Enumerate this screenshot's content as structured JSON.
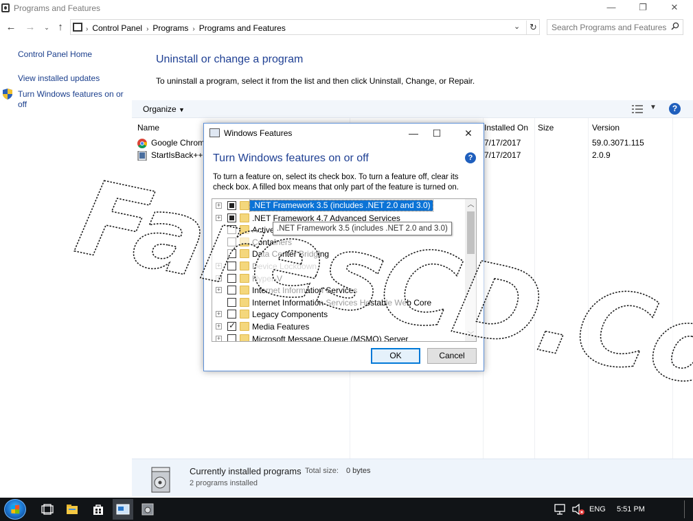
{
  "window": {
    "title": "Programs and Features",
    "min": "—",
    "max": "❐",
    "close": "✕"
  },
  "address": {
    "crumbs": [
      "Control Panel",
      "Programs",
      "Programs and Features"
    ],
    "search_placeholder": "Search Programs and Features"
  },
  "left_pane": {
    "home": "Control Panel Home",
    "updates": "View installed updates",
    "features_line1": "Turn Windows features on or",
    "features_line2": "off"
  },
  "main": {
    "title": "Uninstall or change a program",
    "desc": "To uninstall a program, select it from the list and then click Uninstall, Change, or Repair.",
    "organize": "Organize",
    "columns": {
      "name": "Name",
      "installed_on": "Installed On",
      "size": "Size",
      "version": "Version"
    },
    "programs": [
      {
        "name": "Google Chrom",
        "installed_on": "7/17/2017",
        "size": "",
        "version": "59.0.3071.115"
      },
      {
        "name": "StartIsBack++",
        "installed_on": "7/17/2017",
        "size": "",
        "version": "2.0.9"
      }
    ]
  },
  "details": {
    "title": "Currently installed programs",
    "total_label": "Total size:",
    "total_value": "0 bytes",
    "count": "2 programs installed"
  },
  "dialog": {
    "title": "Windows Features",
    "heading": "Turn Windows features on or off",
    "instructions": "To turn a feature on, select its check box. To turn a feature off, clear its check box. A filled box means that only part of the feature is turned on.",
    "features": [
      {
        "label": ".NET Framework 3.5 (includes .NET 2.0 and 3.0)",
        "state": "partial",
        "expandable": true,
        "selected": true
      },
      {
        "label": ".NET Framework 4.7 Advanced Services",
        "state": "partial",
        "expandable": true
      },
      {
        "label": "Active",
        "state": "unchecked",
        "expandable": false
      },
      {
        "label": "Containers",
        "state": "unchecked",
        "expandable": false
      },
      {
        "label": "Data Center Bridging",
        "state": "unchecked",
        "expandable": false
      },
      {
        "label": "Device Lockdown",
        "state": "unchecked",
        "expandable": true,
        "dim": true
      },
      {
        "label": "Hyper-V",
        "state": "unchecked",
        "expandable": true,
        "dim": true
      },
      {
        "label": "Internet Information Services",
        "state": "unchecked",
        "expandable": true
      },
      {
        "label": "Internet Information Services Hostable Web Core",
        "state": "unchecked",
        "expandable": false
      },
      {
        "label": "Legacy Components",
        "state": "unchecked",
        "expandable": true
      },
      {
        "label": "Media Features",
        "state": "checked",
        "expandable": true
      },
      {
        "label": "Microsoft Message Queue (MSMQ) Server",
        "state": "unchecked",
        "expandable": true
      }
    ],
    "tooltip": ".NET Framework 3.5 (includes .NET 2.0 and 3.0)",
    "ok": "OK",
    "cancel": "Cancel"
  },
  "taskbar": {
    "language": "ENG",
    "time": "5:51 PM"
  },
  "watermark": "FaresCD.Com"
}
